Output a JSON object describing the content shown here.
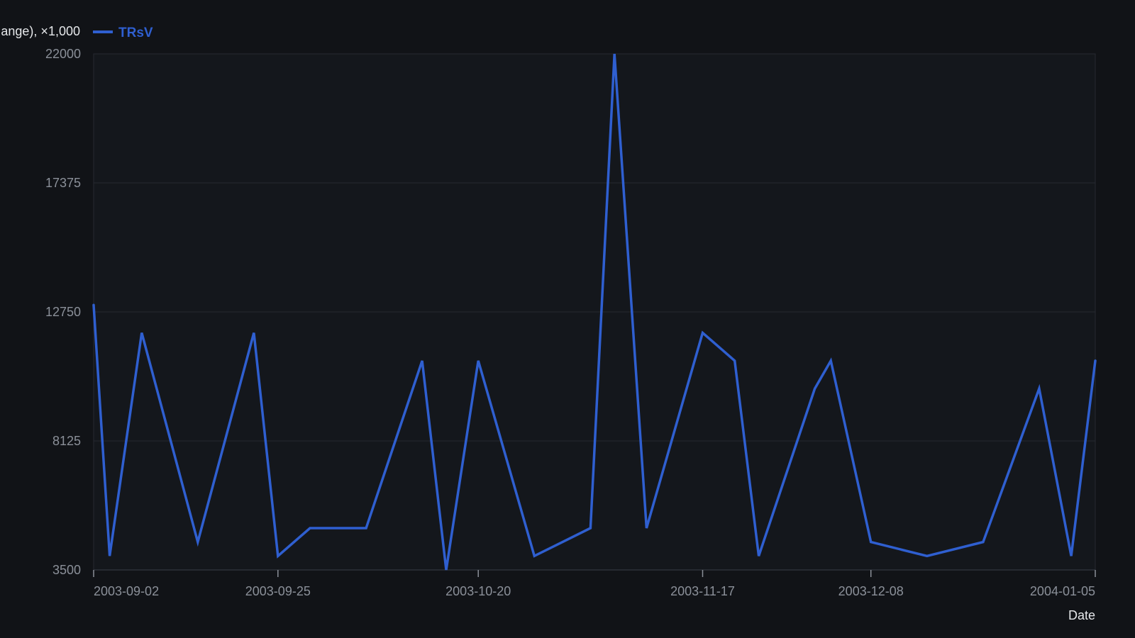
{
  "chart_data": {
    "type": "line",
    "xlabel": "Date",
    "ylabel": "ange), ×1,000",
    "ylim": [
      3500,
      22000
    ],
    "yticks": [
      "3500",
      "8125",
      "12750",
      "17375",
      "22000"
    ],
    "xlim": [
      "2003-09-02",
      "2004-01-05"
    ],
    "xticks": [
      "2003-09-02",
      "2003-09-25",
      "2003-10-20",
      "2003-11-17",
      "2003-12-08",
      "2004-01-05"
    ],
    "grid": true,
    "legend_position": "top-left",
    "series": [
      {
        "name": "TRsV",
        "color": "#2f5fd0",
        "points": [
          [
            "2003-09-02",
            13000
          ],
          [
            "2003-09-04",
            4000
          ],
          [
            "2003-09-08",
            12000
          ],
          [
            "2003-09-15",
            4500
          ],
          [
            "2003-09-22",
            12000
          ],
          [
            "2003-09-25",
            4000
          ],
          [
            "2003-09-29",
            5000
          ],
          [
            "2003-10-06",
            5000
          ],
          [
            "2003-10-13",
            11000
          ],
          [
            "2003-10-16",
            3500
          ],
          [
            "2003-10-20",
            11000
          ],
          [
            "2003-10-27",
            4000
          ],
          [
            "2003-11-03",
            5000
          ],
          [
            "2003-11-06",
            22000
          ],
          [
            "2003-11-10",
            5000
          ],
          [
            "2003-11-17",
            12000
          ],
          [
            "2003-11-21",
            11000
          ],
          [
            "2003-11-24",
            4000
          ],
          [
            "2003-12-01",
            10000
          ],
          [
            "2003-12-03",
            11000
          ],
          [
            "2003-12-08",
            4500
          ],
          [
            "2003-12-15",
            4000
          ],
          [
            "2003-12-22",
            4500
          ],
          [
            "2003-12-29",
            10000
          ],
          [
            "2004-01-02",
            4000
          ],
          [
            "2004-01-05",
            11000
          ]
        ]
      }
    ]
  }
}
